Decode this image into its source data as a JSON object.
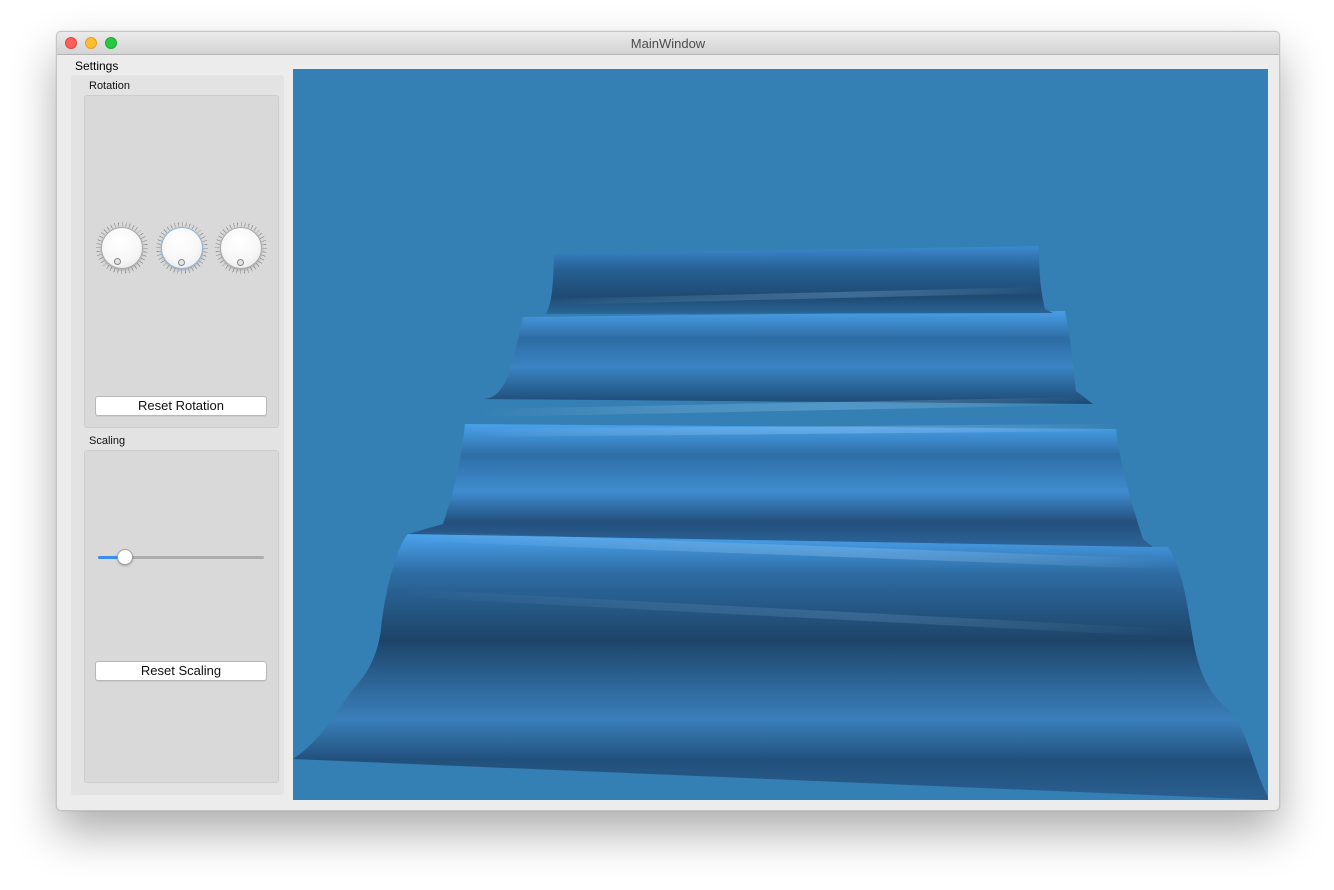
{
  "window": {
    "title": "MainWindow"
  },
  "dock": {
    "title": "Settings",
    "rotation": {
      "label": "Rotation",
      "dials": [
        {
          "name": "x-rotation-dial",
          "value_deg": 180
        },
        {
          "name": "y-rotation-dial",
          "value_deg": 180
        },
        {
          "name": "z-rotation-dial",
          "value_deg": 180
        }
      ],
      "reset_label": "Reset Rotation"
    },
    "scaling": {
      "label": "Scaling",
      "slider_fraction": 0.16,
      "reset_label": "Reset Scaling"
    }
  },
  "viewport": {
    "background_color": "#3480b4",
    "surface_color": "#2f6ea6"
  }
}
